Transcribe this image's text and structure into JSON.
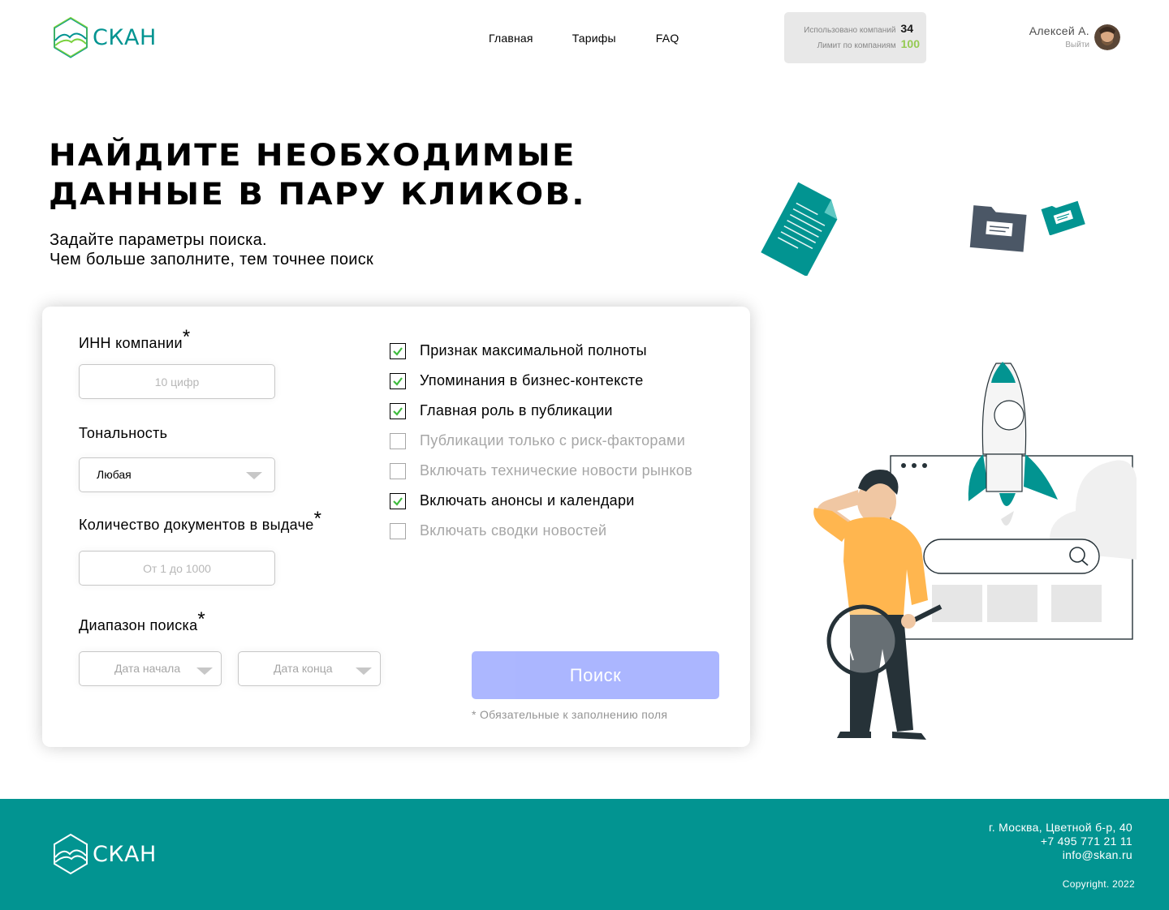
{
  "header": {
    "logo_text": "СКАН",
    "nav": [
      "Главная",
      "Тарифы",
      "FAQ"
    ],
    "limits": {
      "used_label": "Использовано компаний",
      "used_value": "34",
      "limit_label": "Лимит по компаниям",
      "limit_value": "100"
    },
    "user": {
      "name": "Алексей А.",
      "logout": "Выйти"
    }
  },
  "hero": {
    "title_line1": "Найдите необходимые",
    "title_line2": "данные в пару кликов.",
    "subtitle_line1": "Задайте параметры поиска.",
    "subtitle_line2": "Чем больше заполните, тем точнее поиск"
  },
  "form": {
    "inn": {
      "label": "ИНН компании",
      "placeholder": "10 цифр"
    },
    "tone": {
      "label": "Тональность",
      "value": "Любая"
    },
    "docs": {
      "label": "Количество документов в выдаче",
      "placeholder": "От 1 до 1000"
    },
    "range": {
      "label": "Диапазон поиска",
      "start_placeholder": "Дата начала",
      "end_placeholder": "Дата конца"
    },
    "required_mark": "*",
    "checkboxes": [
      {
        "label": "Признак максимальной полноты",
        "checked": true
      },
      {
        "label": "Упоминания в бизнес-контексте",
        "checked": true
      },
      {
        "label": "Главная роль в публикации",
        "checked": true
      },
      {
        "label": "Публикации только с риск-факторами",
        "checked": false
      },
      {
        "label": "Включать технические новости рынков",
        "checked": false
      },
      {
        "label": "Включать анонсы и календари",
        "checked": true
      },
      {
        "label": "Включать сводки новостей",
        "checked": false
      }
    ],
    "submit": "Поиск",
    "required_note": "* Обязательные к заполнению поля"
  },
  "footer": {
    "logo_text": "СКАН",
    "address": "г. Москва, Цветной б-р, 40",
    "phone": "+7 495 771 21 11",
    "email": "info@skan.ru",
    "copyright": "Copyright. 2022"
  },
  "colors": {
    "brand": "#029491",
    "accent": "#8ac540",
    "button": "#5970ff",
    "check": "#7ce3e1"
  }
}
